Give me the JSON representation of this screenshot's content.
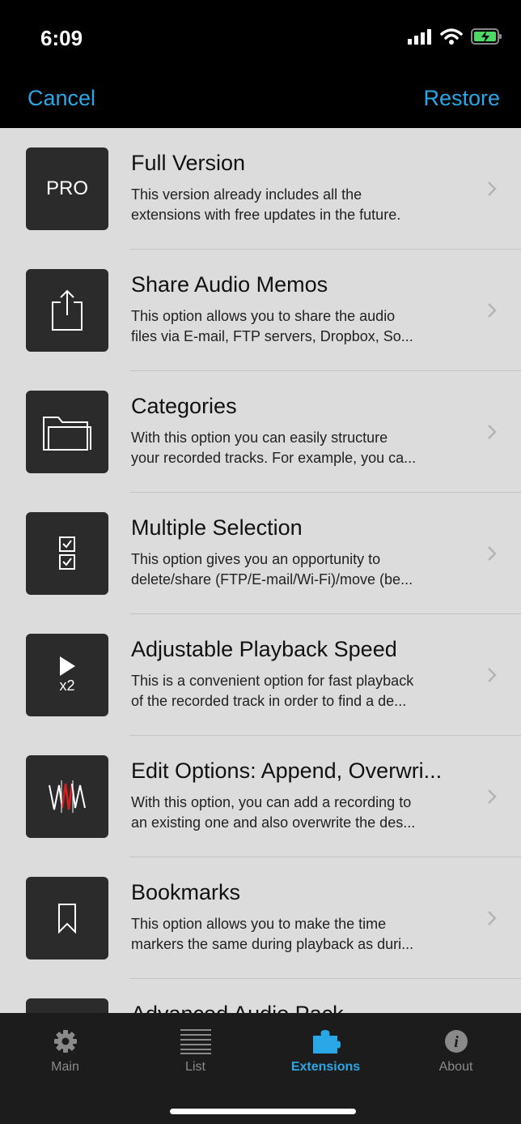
{
  "status": {
    "time": "6:09"
  },
  "nav": {
    "cancel": "Cancel",
    "restore": "Restore"
  },
  "items": [
    {
      "icon": "pro-badge-icon",
      "icon_text": "PRO",
      "title": "Full Version",
      "desc1": "This version already includes all the",
      "desc2": "extensions with free updates in the future."
    },
    {
      "icon": "share-icon",
      "title": "Share Audio Memos",
      "desc1": "This option allows you to share the audio",
      "desc2": "files via E-mail, FTP servers, Dropbox, So..."
    },
    {
      "icon": "folder-icon",
      "title": "Categories",
      "desc1": "With this option you can easily structure",
      "desc2": "your recorded tracks. For example, you ca..."
    },
    {
      "icon": "checkbox-list-icon",
      "title": "Multiple Selection",
      "desc1": "This option gives you an opportunity to",
      "desc2": "delete/share (FTP/E-mail/Wi-Fi)/move (be..."
    },
    {
      "icon": "playback-speed-icon",
      "icon_text": "x2",
      "title": "Adjustable Playback Speed",
      "desc1": "This is a convenient option for fast playback",
      "desc2": "of the recorded track in order to find a de..."
    },
    {
      "icon": "waveform-icon",
      "title": "Edit Options: Append, Overwri...",
      "desc1": "With this option, you can add a recording to",
      "desc2": "an existing one and also overwrite the des..."
    },
    {
      "icon": "bookmark-icon",
      "title": "Bookmarks",
      "desc1": "This option allows you to make the time",
      "desc2": "markers the same during playback as duri..."
    },
    {
      "icon": "audio-pack-icon",
      "title": "Advanced Audio Pack",
      "desc1": "",
      "desc2": ""
    }
  ],
  "tabs": [
    {
      "label": "Main",
      "icon": "gear-icon",
      "active": false
    },
    {
      "label": "List",
      "icon": "list-icon",
      "active": false
    },
    {
      "label": "Extensions",
      "icon": "puzzle-icon",
      "active": true
    },
    {
      "label": "About",
      "icon": "info-icon",
      "active": false
    }
  ],
  "colors": {
    "accent": "#2aa7e6",
    "list_bg": "#dcdcdc",
    "icon_tile": "#2b2b2b",
    "bar_bg": "#000000",
    "tabbar_bg": "#1c1c1c"
  }
}
